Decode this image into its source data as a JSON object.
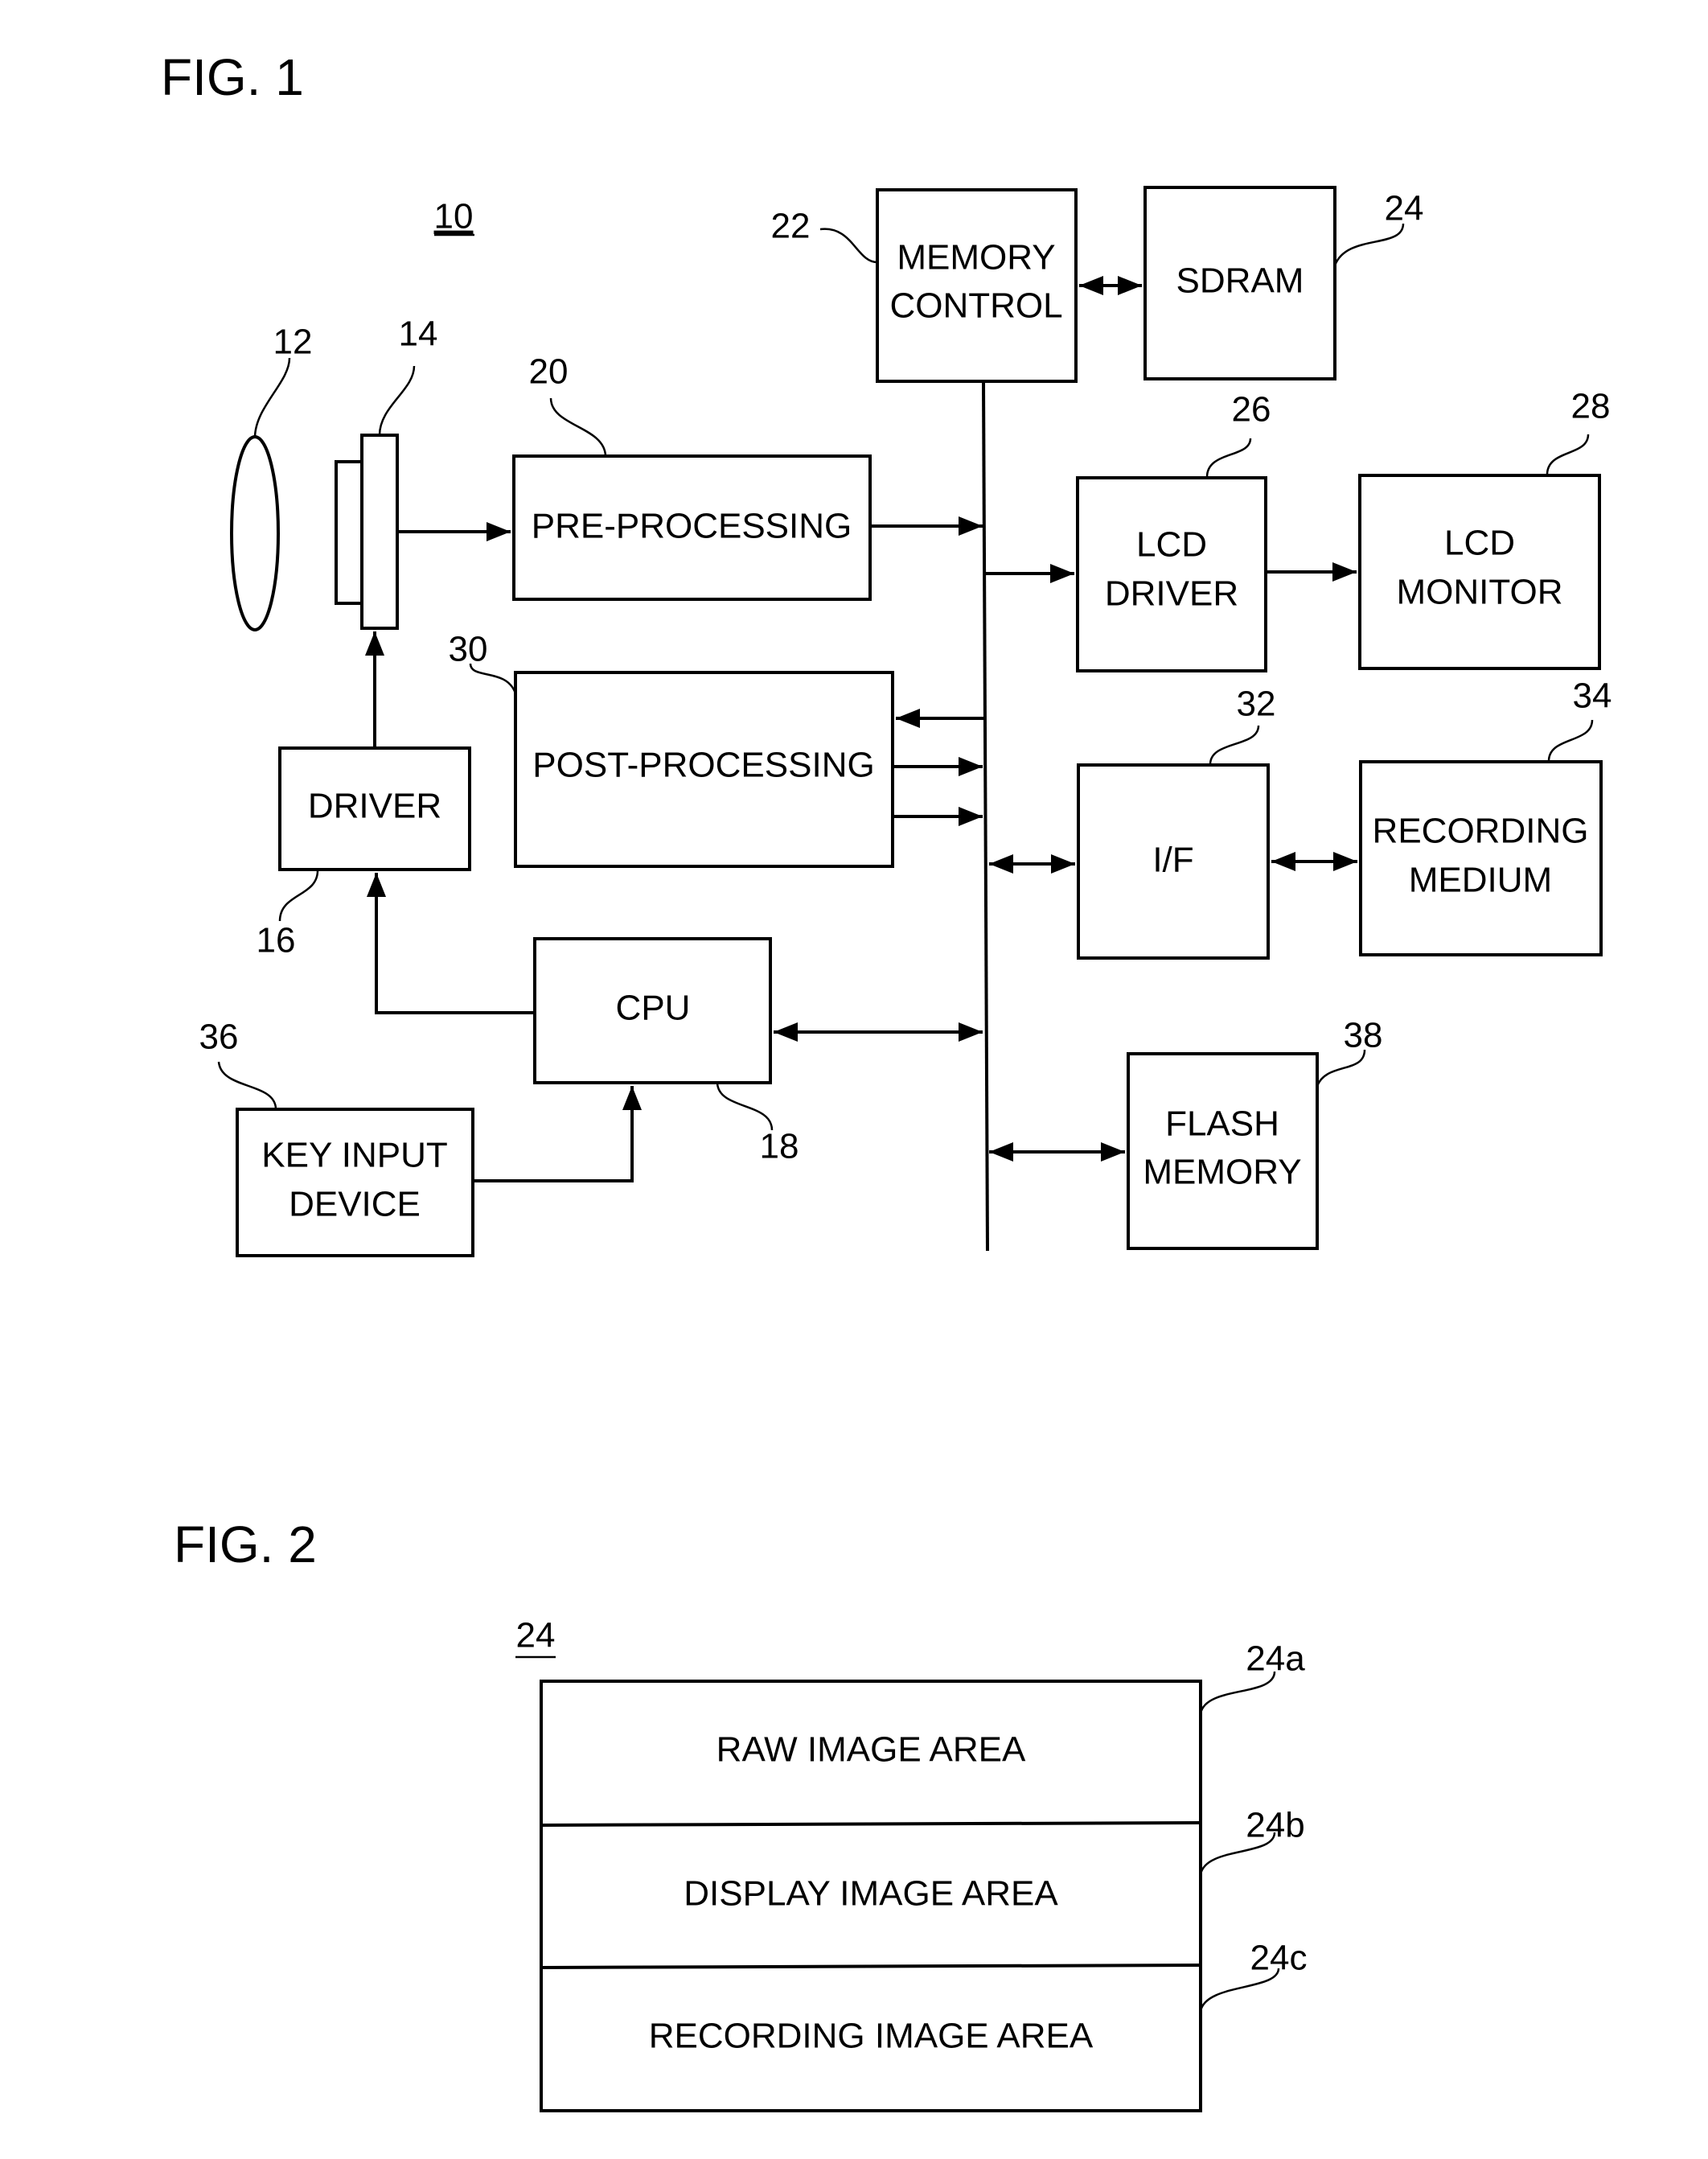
{
  "fig1": {
    "title": "FIG. 1",
    "device_ref": "10",
    "blocks": {
      "lens": {
        "ref": "12"
      },
      "image_sensor": {
        "ref": "14"
      },
      "driver": {
        "ref": "16",
        "line1": "DRIVER"
      },
      "cpu": {
        "ref": "18",
        "line1": "CPU"
      },
      "pre_processing": {
        "ref": "20",
        "line1": "PRE-PROCESSING"
      },
      "memory_control": {
        "ref": "22",
        "line1": "MEMORY",
        "line2": "CONTROL"
      },
      "sdram": {
        "ref": "24",
        "line1": "SDRAM"
      },
      "lcd_driver": {
        "ref": "26",
        "line1": "LCD",
        "line2": "DRIVER"
      },
      "lcd_monitor": {
        "ref": "28",
        "line1": "LCD",
        "line2": "MONITOR"
      },
      "post_processing": {
        "ref": "30",
        "line1": "POST-PROCESSING"
      },
      "interface": {
        "ref": "32",
        "line1": "I/F"
      },
      "recording_medium": {
        "ref": "34",
        "line1": "RECORDING",
        "line2": "MEDIUM"
      },
      "key_input_device": {
        "ref": "36",
        "line1": "KEY INPUT",
        "line2": "DEVICE"
      },
      "flash_memory": {
        "ref": "38",
        "line1": "FLASH",
        "line2": "MEMORY"
      }
    }
  },
  "fig2": {
    "title": "FIG. 2",
    "memory_ref": "24",
    "areas": [
      {
        "ref": "24a",
        "label": "RAW IMAGE AREA"
      },
      {
        "ref": "24b",
        "label": "DISPLAY IMAGE AREA"
      },
      {
        "ref": "24c",
        "label": "RECORDING IMAGE AREA"
      }
    ]
  }
}
